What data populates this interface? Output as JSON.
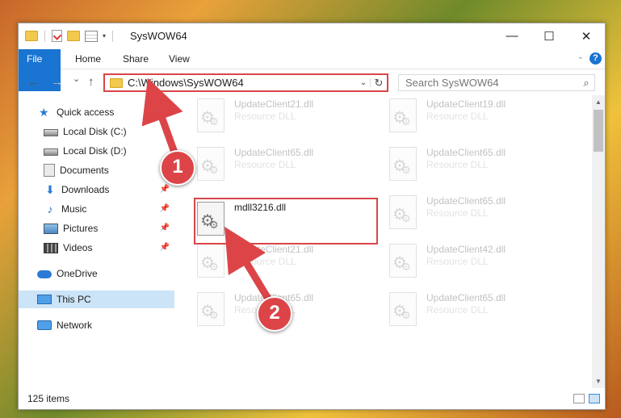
{
  "window": {
    "title": "SysWOW64"
  },
  "titlebar": {
    "minimize": "—",
    "maximize": "☐",
    "close": "✕"
  },
  "ribbon": {
    "tabs": [
      "File",
      "Home",
      "Share",
      "View"
    ]
  },
  "navbar": {
    "back": "←",
    "forward": "→",
    "recent": "⌄",
    "up": "↑",
    "path": "C:\\Windows\\SysWOW64",
    "dropdown": "⌄",
    "refresh": "↻",
    "search_placeholder": "Search SysWOW64"
  },
  "sidebar": {
    "items": [
      {
        "label": "Quick access",
        "pinned": false
      },
      {
        "label": "Local Disk (C:)",
        "pinned": false
      },
      {
        "label": "Local Disk (D:)",
        "pinned": false
      },
      {
        "label": "Documents",
        "pinned": false
      },
      {
        "label": "Downloads",
        "pinned": true
      },
      {
        "label": "Music",
        "pinned": true
      },
      {
        "label": "Pictures",
        "pinned": true
      },
      {
        "label": "Videos",
        "pinned": true
      },
      {
        "label": "OneDrive",
        "pinned": false
      },
      {
        "label": "This PC",
        "pinned": false,
        "selected": true
      },
      {
        "label": "Network",
        "pinned": false
      }
    ]
  },
  "files": [
    {
      "name": "UpdateClient21.dll",
      "type": "Resource DLL",
      "faded": true
    },
    {
      "name": "UpdateClient19.dll",
      "type": "Resource DLL",
      "faded": true
    },
    {
      "name": "UpdateClient65.dll",
      "type": "Resource DLL",
      "faded": true
    },
    {
      "name": "UpdateClient65.dll",
      "type": "Resource DLL",
      "faded": true
    },
    {
      "name": "mdll3216.dll",
      "type": "",
      "faded": false
    },
    {
      "name": "UpdateClient65.dll",
      "type": "Resource DLL",
      "faded": true
    },
    {
      "name": "UpdateClient21.dll",
      "type": "Resource DLL",
      "faded": true
    },
    {
      "name": "UpdateClient42.dll",
      "type": "Resource DLL",
      "faded": true
    },
    {
      "name": "UpdateClient65.dll",
      "type": "Resource DLL",
      "faded": true
    },
    {
      "name": "UpdateClient65.dll",
      "type": "Resource DLL",
      "faded": true
    }
  ],
  "status": {
    "item_count": "125 items"
  },
  "callouts": {
    "step1": "1",
    "step2": "2"
  },
  "colors": {
    "accent": "#1a74d2",
    "highlight": "#d9454a",
    "selection": "#cce4f7"
  }
}
